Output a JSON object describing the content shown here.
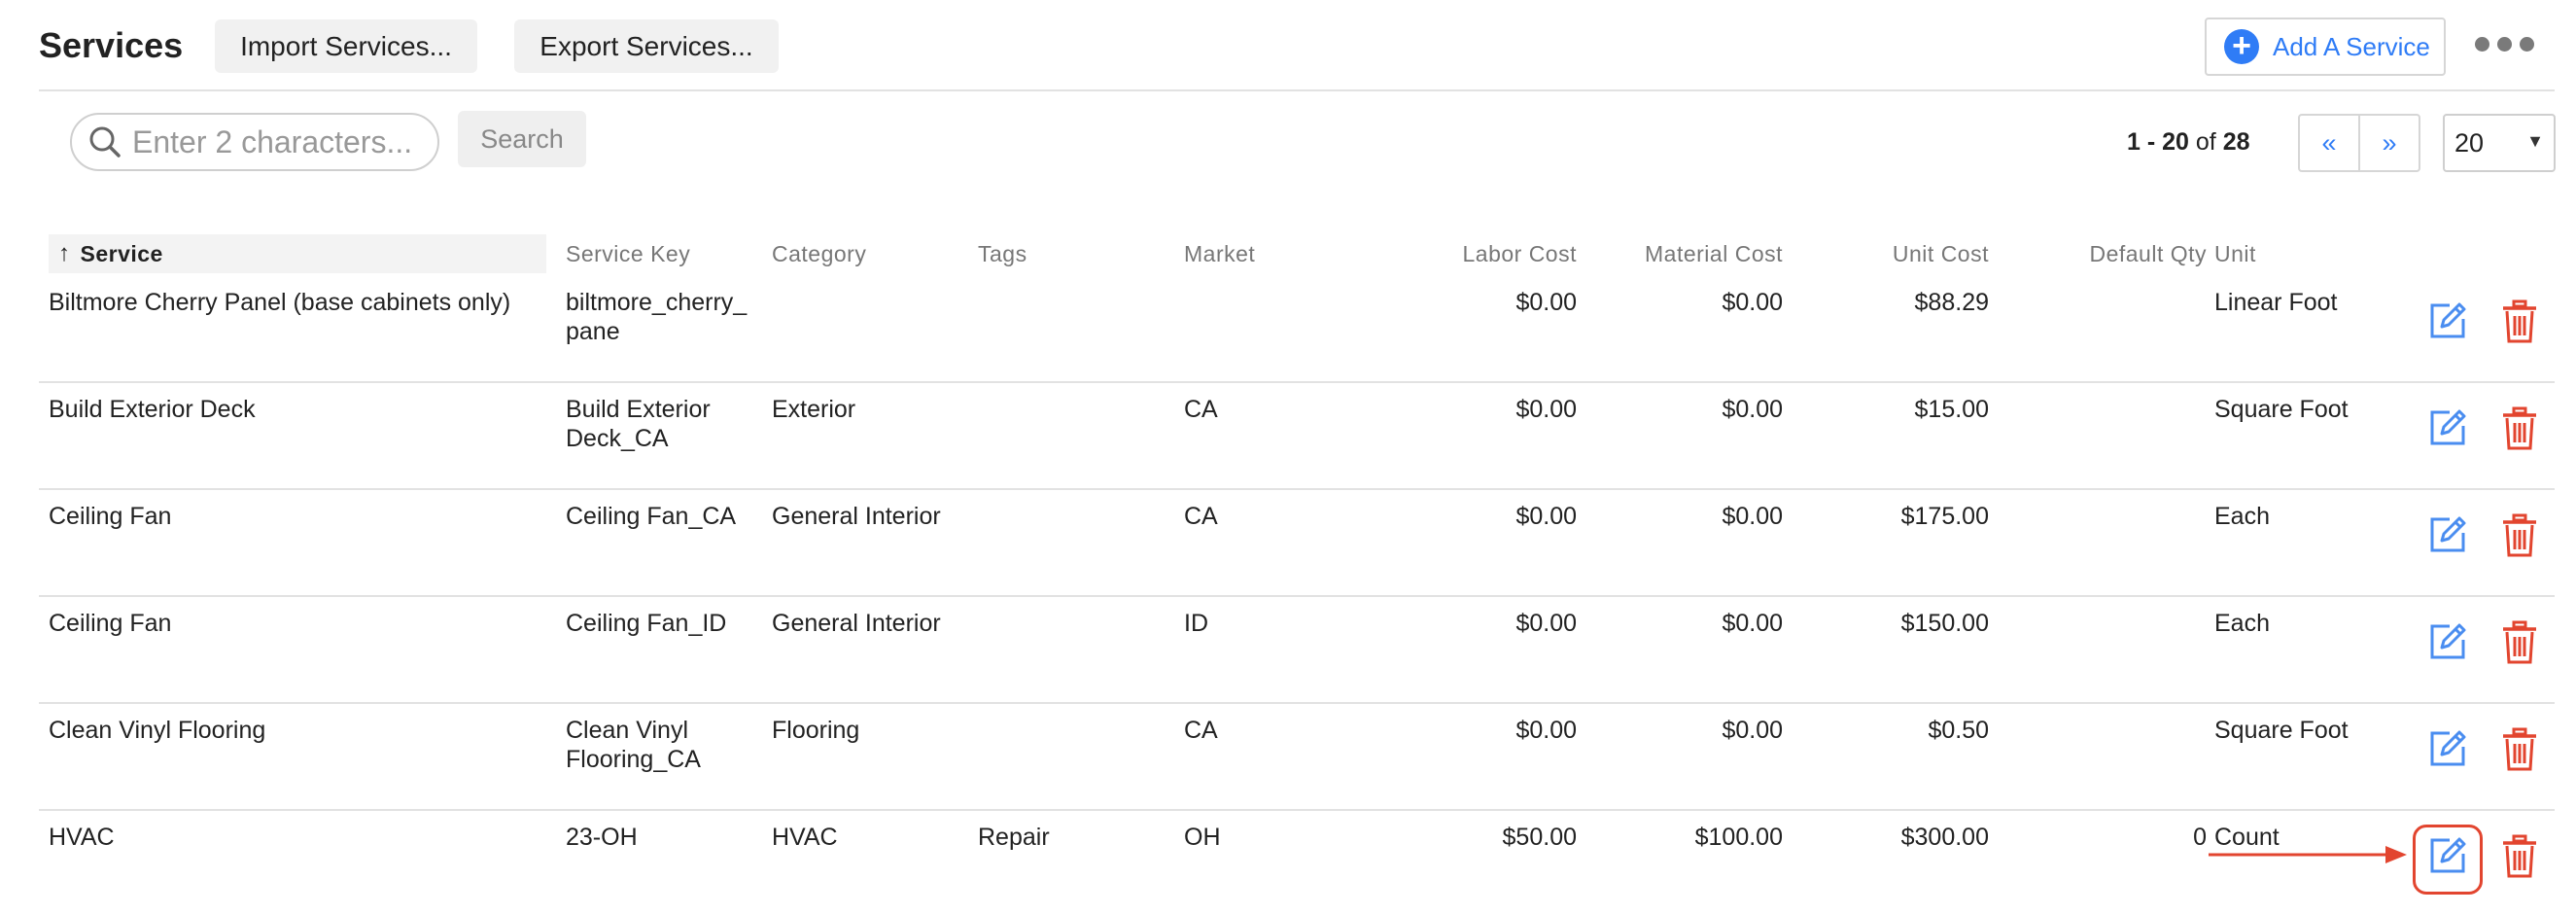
{
  "header": {
    "title": "Services",
    "import_label": "Import Services...",
    "export_label": "Export Services...",
    "add_label": "Add A Service"
  },
  "search": {
    "placeholder": "Enter 2 characters...",
    "button_label": "Search"
  },
  "pagination": {
    "range_start": "1",
    "range_sep": " - ",
    "range_end": "20",
    "of_label": " of ",
    "total": "28",
    "prev_label": "«",
    "next_label": "»",
    "page_size": "20"
  },
  "table": {
    "columns": {
      "service": "Service",
      "service_key": "Service Key",
      "category": "Category",
      "tags": "Tags",
      "market": "Market",
      "labor_cost": "Labor Cost",
      "material_cost": "Material Cost",
      "unit_cost": "Unit Cost",
      "default_qty": "Default Qty",
      "unit": "Unit"
    },
    "rows": [
      {
        "service": "Biltmore Cherry Panel (base cabinets only)",
        "key_line1": "biltmore_cherry_",
        "key_line2": "pane",
        "category": "",
        "tags": "",
        "market": "",
        "labor": "$0.00",
        "material": "$0.00",
        "unit_cost": "$88.29",
        "qty": "",
        "unit": "Linear Foot"
      },
      {
        "service": "Build Exterior Deck",
        "key_line1": "Build Exterior",
        "key_line2": "Deck_CA",
        "category": "Exterior",
        "tags": "",
        "market": "CA",
        "labor": "$0.00",
        "material": "$0.00",
        "unit_cost": "$15.00",
        "qty": "",
        "unit": "Square Foot"
      },
      {
        "service": "Ceiling Fan",
        "key_line1": "Ceiling Fan_CA",
        "key_line2": "",
        "category": "General Interior",
        "tags": "",
        "market": "CA",
        "labor": "$0.00",
        "material": "$0.00",
        "unit_cost": "$175.00",
        "qty": "",
        "unit": "Each"
      },
      {
        "service": "Ceiling Fan",
        "key_line1": "Ceiling Fan_ID",
        "key_line2": "",
        "category": "General Interior",
        "tags": "",
        "market": "ID",
        "labor": "$0.00",
        "material": "$0.00",
        "unit_cost": "$150.00",
        "qty": "",
        "unit": "Each"
      },
      {
        "service": "Clean Vinyl Flooring",
        "key_line1": "Clean Vinyl",
        "key_line2": "Flooring_CA",
        "category": "Flooring",
        "tags": "",
        "market": "CA",
        "labor": "$0.00",
        "material": "$0.00",
        "unit_cost": "$0.50",
        "qty": "",
        "unit": "Square Foot"
      },
      {
        "service": "HVAC",
        "key_line1": "23-OH",
        "key_line2": "",
        "category": "HVAC",
        "tags": "Repair",
        "market": "OH",
        "labor": "$50.00",
        "material": "$100.00",
        "unit_cost": "$300.00",
        "qty": "0",
        "unit": "Count"
      }
    ]
  },
  "colors": {
    "accent": "#2f7cf6",
    "delete": "#e2452f",
    "highlight": "#e2452f"
  }
}
